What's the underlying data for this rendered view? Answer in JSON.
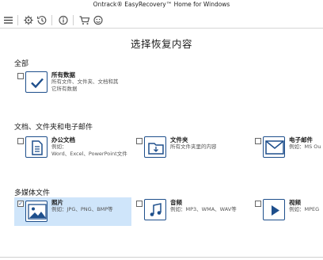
{
  "app": {
    "title": "Ontrack® EasyRecovery™ Home for Windows"
  },
  "toolbar": {
    "menu_icon": "hamburger-menu-icon",
    "settings_icon": "gear-icon",
    "history_icon": "history-icon",
    "info_icon": "info-icon",
    "cart_icon": "cart-icon",
    "support_icon": "support-face-icon"
  },
  "page": {
    "title": "选择恢复内容"
  },
  "sections": {
    "all": {
      "title": "全部",
      "items": [
        {
          "name": "所有数据",
          "desc_line1": "所有文件、文件夹、文档和其",
          "desc_line2": "它所有数据",
          "checked": false,
          "icon": "checkmark-icon"
        }
      ]
    },
    "docs": {
      "title": "文档、文件夹和电子邮件",
      "items": [
        {
          "name": "办公文档",
          "desc_line1": "例如：",
          "desc_line2": "Word、Excel、PowerPoint文件",
          "checked": false,
          "icon": "document-icon"
        },
        {
          "name": "文件夹",
          "desc_line1": "所有文件夹里的内容",
          "desc_line2": "",
          "checked": false,
          "icon": "folder-icon"
        },
        {
          "name": "电子邮件",
          "desc_line1": "例如：MS Ou",
          "desc_line2": "",
          "checked": false,
          "icon": "envelope-icon"
        }
      ]
    },
    "media": {
      "title": "多媒体文件",
      "items": [
        {
          "name": "照片",
          "desc_line1": "例如：JPG、PNG、BMP等",
          "desc_line2": "",
          "checked": true,
          "check_mark": "✓",
          "icon": "photo-icon"
        },
        {
          "name": "音频",
          "desc_line1": "例如：MP3、WMA、WAV等",
          "desc_line2": "",
          "checked": false,
          "icon": "music-note-icon"
        },
        {
          "name": "视频",
          "desc_line1": "例如：MPEG",
          "desc_line2": "",
          "checked": false,
          "icon": "play-icon"
        }
      ]
    }
  },
  "colors": {
    "accent": "#1e4f8c",
    "selected_bg": "#cfe5fa"
  }
}
